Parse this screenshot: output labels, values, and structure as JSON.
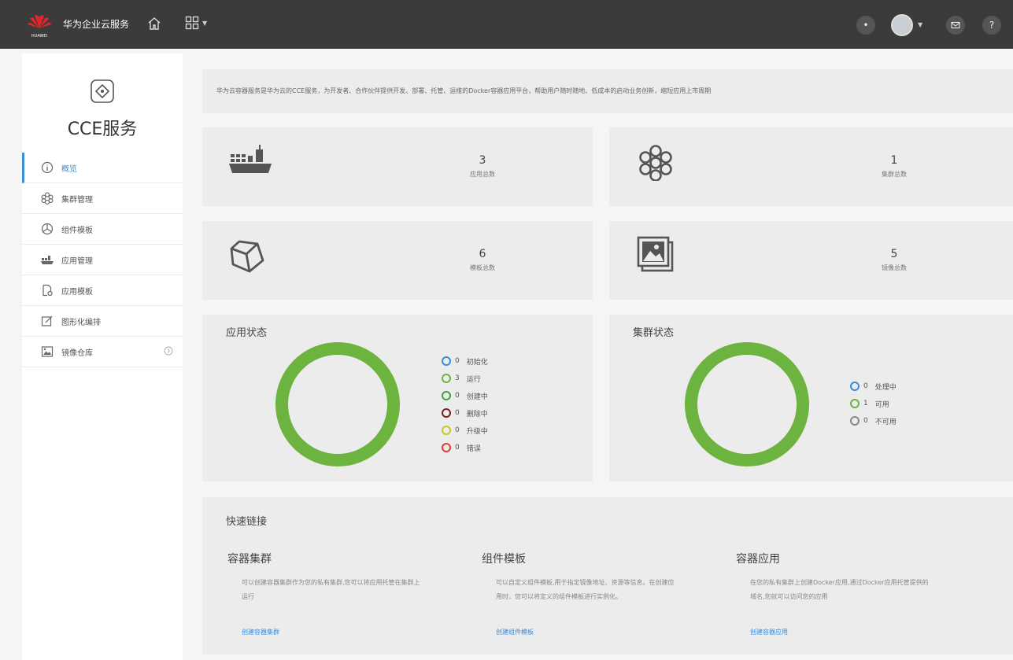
{
  "topbar": {
    "logo_text": "HUAWEI",
    "brand": "华为企业云服务",
    "icons": [
      "home-icon",
      "apps-grid-icon",
      "notification-icon",
      "avatar",
      "mail-icon",
      "help-icon"
    ],
    "help_label": "?"
  },
  "sidebar": {
    "service_title": "CCE服务",
    "items": [
      {
        "label": "概览",
        "icon": "info-circle-icon",
        "active": true
      },
      {
        "label": "集群管理",
        "icon": "cluster-icon"
      },
      {
        "label": "组件模板",
        "icon": "component-icon"
      },
      {
        "label": "应用管理",
        "icon": "ship-icon"
      },
      {
        "label": "应用模板",
        "icon": "doc-gear-icon"
      },
      {
        "label": "图形化编排",
        "icon": "edit-icon"
      },
      {
        "label": "镜像仓库",
        "icon": "image-icon"
      }
    ]
  },
  "intro": {
    "text": "华为云容器服务是华为云的CCE服务，为开发者、合作伙伴提供开发、部署、托管、运维的Docker容器应用平台，帮助用户随时随地、低成本的启动业务创新，缩短应用上市周期"
  },
  "stats": [
    {
      "value": "3",
      "label": "应用总数",
      "icon": "ship-icon"
    },
    {
      "value": "1",
      "label": "集群总数",
      "icon": "cluster-icon"
    },
    {
      "value": "6",
      "label": "模板总数",
      "icon": "cube-icon"
    },
    {
      "value": "5",
      "label": "镜像总数",
      "icon": "images-icon"
    }
  ],
  "app_status": {
    "title": "应用状态",
    "ring_color": "#6db33f",
    "legend": [
      {
        "count": "0",
        "label": "初始化",
        "color": "#3b8cd9"
      },
      {
        "count": "3",
        "label": "运行",
        "color": "#6db33f"
      },
      {
        "count": "0",
        "label": "创建中",
        "color": "#3fa33f"
      },
      {
        "count": "0",
        "label": "删除中",
        "color": "#7a1f1f"
      },
      {
        "count": "0",
        "label": "升级中",
        "color": "#c8c81e"
      },
      {
        "count": "0",
        "label": "错误",
        "color": "#e53935"
      }
    ]
  },
  "cluster_status": {
    "title": "集群状态",
    "ring_color": "#6db33f",
    "legend": [
      {
        "count": "0",
        "label": "处理中",
        "color": "#3b8cd9"
      },
      {
        "count": "1",
        "label": "可用",
        "color": "#6db33f"
      },
      {
        "count": "0",
        "label": "不可用",
        "color": "#888888"
      }
    ]
  },
  "quick_links": {
    "title": "快速链接",
    "columns": [
      {
        "title": "容器集群",
        "desc": "可以创建容器集群作为您的私有集群,您可以将应用托管在集群上运行",
        "link": "创建容器集群"
      },
      {
        "title": "组件模板",
        "desc": "可以自定义组件模板,用于指定镜像地址、资源等信息。在创建应用时，您可以将定义的组件模板进行实例化。",
        "link": "创建组件模板"
      },
      {
        "title": "容器应用",
        "desc": "在您的私有集群上创建Docker应用,通过Docker应用托管提供的域名,您就可以访问您的应用",
        "link": "创建容器应用"
      }
    ]
  }
}
